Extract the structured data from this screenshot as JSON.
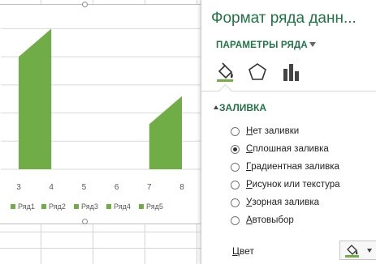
{
  "chart_data": {
    "type": "area",
    "x": [
      "3",
      "4",
      "5",
      "6",
      "7",
      "8"
    ],
    "series": [
      {
        "name": "Ряд1",
        "values": [
          null,
          null,
          null,
          null,
          null,
          null
        ]
      },
      {
        "name": "Ряд2",
        "values": [
          null,
          null,
          null,
          null,
          null,
          null
        ]
      },
      {
        "name": "Ряд3",
        "values": [
          null,
          null,
          null,
          null,
          null,
          null
        ]
      },
      {
        "name": "Ряд4",
        "values": [
          80,
          100,
          0,
          0,
          32,
          52
        ]
      },
      {
        "name": "Ряд5",
        "values": [
          null,
          null,
          null,
          null,
          null,
          null
        ]
      }
    ],
    "ylim": [
      0,
      110
    ],
    "grid": true,
    "legend_placement": "bottom",
    "series_color": "#70ad47"
  },
  "pane": {
    "title": "Формат ряда данн...",
    "section": "ПАРАМЕТРЫ РЯДА",
    "tabs": [
      {
        "icon": "fill-bucket-icon"
      },
      {
        "icon": "pentagon-icon"
      },
      {
        "icon": "bar-chart-icon"
      }
    ],
    "fill": {
      "header": "ЗАЛИВКА",
      "options": [
        {
          "prefix": "",
          "mnemonic": "Н",
          "rest": "ет заливки",
          "checked": false
        },
        {
          "prefix": "",
          "mnemonic": "С",
          "rest": "плошная заливка",
          "checked": true
        },
        {
          "prefix": "",
          "mnemonic": "Г",
          "rest": "радиентная заливка",
          "checked": false
        },
        {
          "prefix": "",
          "mnemonic": "Р",
          "rest": "исунок или текстура",
          "checked": false
        },
        {
          "prefix": "",
          "mnemonic": "У",
          "rest": "зорная заливка",
          "checked": false
        },
        {
          "prefix": "",
          "mnemonic": "А",
          "rest": "втовыбор",
          "checked": false
        }
      ]
    },
    "color": {
      "prefix": "Ц",
      "label": "вет",
      "swatch": "#70ad47"
    }
  },
  "colors": {
    "accent": "#217346",
    "series": "#70ad47"
  }
}
